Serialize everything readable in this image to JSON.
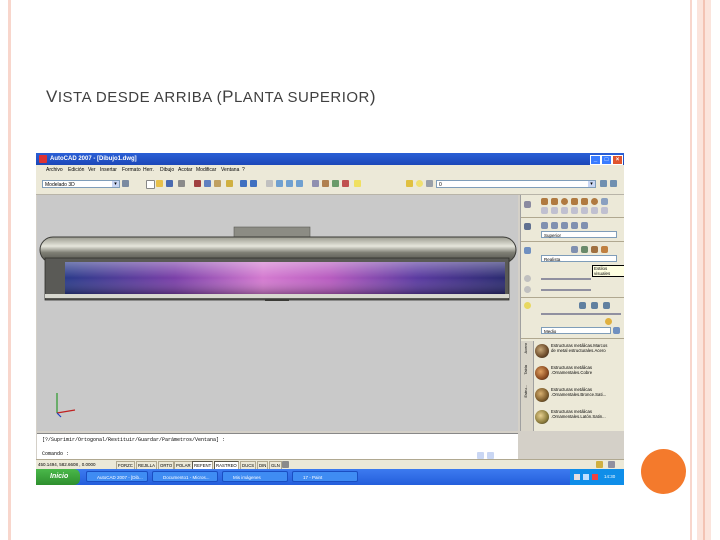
{
  "slide": {
    "title_first_cap": "V",
    "title_rest_1": "ISTA DESDE ARRIBA (",
    "title_cap_2": "P",
    "title_rest_2": "LANTA SUPERIOR",
    "title_end": ")"
  },
  "window": {
    "title": "AutoCAD 2007 - [Dibujo1.dwg]"
  },
  "menu": [
    "Archivo",
    "Edición",
    "Ver",
    "Insertar",
    "Formato",
    "Herr.",
    "Dibujo",
    "Acotar",
    "Modificar",
    "Ventana",
    "?"
  ],
  "toolbar": {
    "workspace_value": "Modelado 3D",
    "layer_value": "0"
  },
  "palette": {
    "view_value": "Superior",
    "visual_style_value": "Realista",
    "tooltip": "Estilos visuales",
    "quality_value": "Medio",
    "tabs": [
      "Acero",
      "Tabla",
      "Estru..."
    ],
    "materials": [
      {
        "line1": "Estructuras metálicas.Marcos",
        "line2": "de metal estructurales.Acero"
      },
      {
        "line1": "Estructuras metálicas",
        "line2": ".Ornamentales.Cobre"
      },
      {
        "line1": "Estructuras metálicas",
        "line2": ".Ornamentales.Bronce.Sati..."
      },
      {
        "line1": "Estructuras metálicas",
        "line2": ".Ornamentales.Latón.Satin..."
      }
    ]
  },
  "command": {
    "line1": "[?/Suprimir/Ortogonal/Restituir/Guardar/Parámetros/Ventana] :",
    "line2": "Comando :"
  },
  "status": {
    "coords": "450.1494, 582.6608 , 0.0000",
    "buttons": [
      "FORZC",
      "REJILLA",
      "ORTO",
      "POLAR",
      "REFENT",
      "RASTREO",
      "DUCS",
      "DIN",
      "GLN"
    ]
  },
  "taskbar": {
    "start": "Inicio",
    "tasks": [
      "AutoCAD 2007 - [Dib...",
      "Documento1 - Micros...",
      "Mis imágenes",
      "17 - Paint"
    ],
    "clock": "14:30"
  },
  "colors": {
    "stripe": "#f8d6cc",
    "accent": "#f47a2c",
    "xp_blue": "#245edb"
  }
}
